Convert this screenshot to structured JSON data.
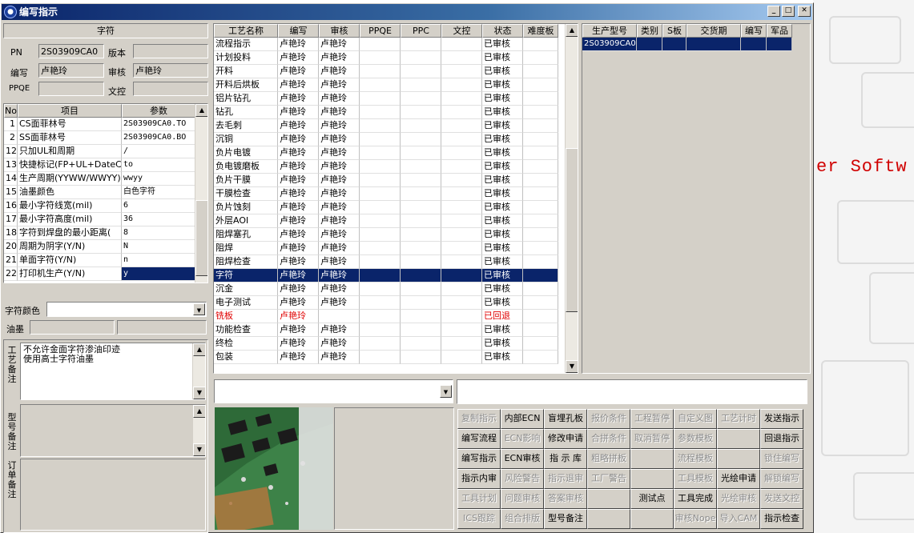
{
  "window": {
    "title": "编写指示"
  },
  "background_text": "er Softw",
  "info": {
    "section_title": "字符",
    "pn_label": "PN",
    "pn_value": "2S03909CA0",
    "version_label": "版本",
    "version_value": "",
    "writer_label": "编写",
    "writer_value": "卢艳玲",
    "reviewer_label": "审核",
    "reviewer_value": "卢艳玲",
    "ppqe_label": "PPQE",
    "ppqe_value": "",
    "doc_label": "文控",
    "doc_value": ""
  },
  "params": {
    "headers": [
      "No",
      "项目",
      "参数"
    ],
    "rows": [
      [
        "1",
        "CS面菲林号",
        "2S03909CA0.TO"
      ],
      [
        "2",
        "SS面菲林号",
        "2S03909CA0.BO"
      ],
      [
        "12",
        "只加UL和周期",
        "/"
      ],
      [
        "13",
        "快捷标记(FP+UL+DateCo",
        "to"
      ],
      [
        "14",
        "生产周期(YYWW/WWYY)",
        "wwyy"
      ],
      [
        "15",
        "油墨颜色",
        "白色字符"
      ],
      [
        "16",
        "最小字符线宽(mil)",
        "6"
      ],
      [
        "17",
        "最小字符高度(mil)",
        "36"
      ],
      [
        "18",
        "字符到焊盘的最小距离(",
        "8"
      ],
      [
        "20",
        "周期为阴字(Y/N)",
        "N"
      ],
      [
        "21",
        "单面字符(Y/N)",
        "n"
      ],
      [
        "22",
        "打印机生产(Y/N)",
        "y"
      ]
    ]
  },
  "char_color": {
    "label": "字符颜色",
    "value": ""
  },
  "ink": {
    "label": "油墨",
    "value1": "",
    "value2": ""
  },
  "notes": {
    "process_title": "工艺备注",
    "process_lines": [
      "不允许金面字符渗油印迹",
      "使用高士字符油墨"
    ],
    "model_title": "型号备注",
    "order_title": "订单备注"
  },
  "process": {
    "headers": [
      "工艺名称",
      "编写",
      "审核",
      "PPQE",
      "PPC",
      "文控",
      "状态",
      "难度板"
    ],
    "rows": [
      [
        "流程指示",
        "卢艳玲",
        "卢艳玲",
        "",
        "",
        "",
        "已审核",
        ""
      ],
      [
        "计划投料",
        "卢艳玲",
        "卢艳玲",
        "",
        "",
        "",
        "已审核",
        ""
      ],
      [
        "开料",
        "卢艳玲",
        "卢艳玲",
        "",
        "",
        "",
        "已审核",
        ""
      ],
      [
        "开料后烘板",
        "卢艳玲",
        "卢艳玲",
        "",
        "",
        "",
        "已审核",
        ""
      ],
      [
        "铝片钻孔",
        "卢艳玲",
        "卢艳玲",
        "",
        "",
        "",
        "已审核",
        ""
      ],
      [
        "钻孔",
        "卢艳玲",
        "卢艳玲",
        "",
        "",
        "",
        "已审核",
        ""
      ],
      [
        "去毛刺",
        "卢艳玲",
        "卢艳玲",
        "",
        "",
        "",
        "已审核",
        ""
      ],
      [
        "沉铜",
        "卢艳玲",
        "卢艳玲",
        "",
        "",
        "",
        "已审核",
        ""
      ],
      [
        "负片电镀",
        "卢艳玲",
        "卢艳玲",
        "",
        "",
        "",
        "已审核",
        ""
      ],
      [
        "负电镀磨板",
        "卢艳玲",
        "卢艳玲",
        "",
        "",
        "",
        "已审核",
        ""
      ],
      [
        "负片干膜",
        "卢艳玲",
        "卢艳玲",
        "",
        "",
        "",
        "已审核",
        ""
      ],
      [
        "干膜检查",
        "卢艳玲",
        "卢艳玲",
        "",
        "",
        "",
        "已审核",
        ""
      ],
      [
        "负片蚀刻",
        "卢艳玲",
        "卢艳玲",
        "",
        "",
        "",
        "已审核",
        ""
      ],
      [
        "外层AOI",
        "卢艳玲",
        "卢艳玲",
        "",
        "",
        "",
        "已审核",
        ""
      ],
      [
        "阻焊塞孔",
        "卢艳玲",
        "卢艳玲",
        "",
        "",
        "",
        "已审核",
        ""
      ],
      [
        "阻焊",
        "卢艳玲",
        "卢艳玲",
        "",
        "",
        "",
        "已审核",
        ""
      ],
      [
        "阻焊检查",
        "卢艳玲",
        "卢艳玲",
        "",
        "",
        "",
        "已审核",
        ""
      ],
      [
        "字符",
        "卢艳玲",
        "卢艳玲",
        "",
        "",
        "",
        "已审核",
        ""
      ],
      [
        "沉金",
        "卢艳玲",
        "卢艳玲",
        "",
        "",
        "",
        "已审核",
        ""
      ],
      [
        "电子测试",
        "卢艳玲",
        "卢艳玲",
        "",
        "",
        "",
        "已审核",
        ""
      ],
      [
        "铣板",
        "卢艳玲",
        "",
        "",
        "",
        "",
        "已回退",
        ""
      ],
      [
        "功能检查",
        "卢艳玲",
        "卢艳玲",
        "",
        "",
        "",
        "已审核",
        ""
      ],
      [
        "终检",
        "卢艳玲",
        "卢艳玲",
        "",
        "",
        "",
        "已审核",
        ""
      ],
      [
        "包装",
        "卢艳玲",
        "卢艳玲",
        "",
        "",
        "",
        "已审核",
        ""
      ]
    ],
    "selected_index": 17,
    "returned_index": 20
  },
  "models": {
    "headers": [
      "生产型号",
      "类别",
      "S板",
      "交货期",
      "编写",
      "军品"
    ],
    "rows": [
      [
        "2S03909CA0",
        "",
        "",
        "",
        "",
        ""
      ]
    ]
  },
  "buttons": [
    [
      "复制指示",
      "内部ECN",
      "盲埋孔板",
      "报价条件",
      "工程暂停",
      "自定义图",
      "工艺计时",
      "发送指示"
    ],
    [
      "编写流程",
      "ECN影响",
      "修改申请",
      "合拼条件",
      "取消暂停",
      "参数模板",
      "",
      "回退指示"
    ],
    [
      "编写指示",
      "ECN审核",
      "指 示 库",
      "粗略拼板",
      "",
      "流程模板",
      "",
      "锁住编写"
    ],
    [
      "指示内审",
      "风险警告",
      "指示退审",
      "工厂警告",
      "",
      "工具模板",
      "光绘申请",
      "解锁编写"
    ],
    [
      "工具计划",
      "问题审核",
      "答案审核",
      "",
      "测试点",
      "工具完成",
      "光绘审核",
      "发送文控"
    ],
    [
      "ICS跟踪",
      "组合排版",
      "型号备注",
      "",
      "",
      "审核Nope",
      "导入CAM",
      "指示检查"
    ]
  ],
  "disabled_buttons": [
    [
      true,
      false,
      false,
      true,
      true,
      true,
      true,
      false
    ],
    [
      false,
      true,
      false,
      true,
      true,
      true,
      false,
      false
    ],
    [
      false,
      false,
      false,
      true,
      false,
      true,
      false,
      true
    ],
    [
      false,
      true,
      true,
      true,
      false,
      true,
      false,
      true
    ],
    [
      true,
      true,
      true,
      false,
      false,
      false,
      true,
      true
    ],
    [
      true,
      true,
      false,
      false,
      false,
      true,
      true,
      false
    ]
  ],
  "colors": {
    "selection": "#0a246a",
    "returned": "#e00000",
    "face": "#d4d0c8"
  }
}
